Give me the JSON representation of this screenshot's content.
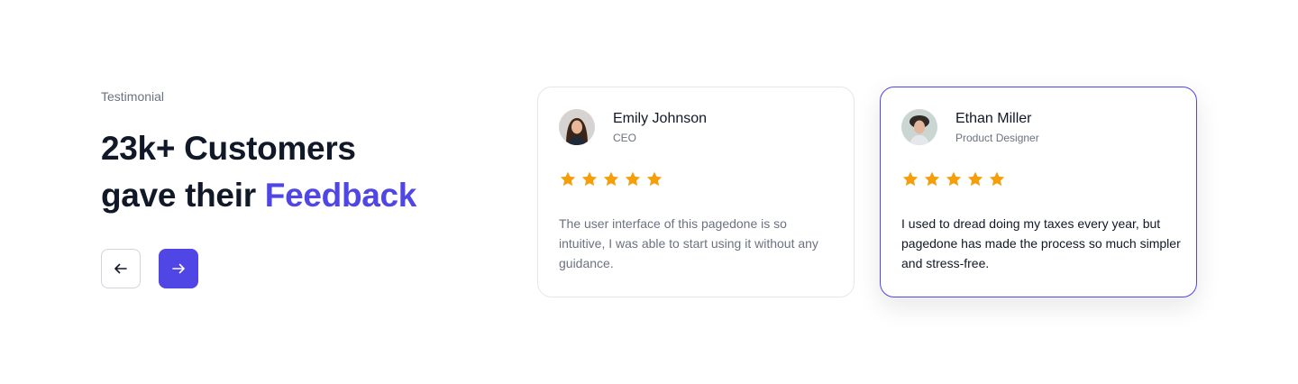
{
  "section": {
    "eyebrow": "Testimonial",
    "headline_line1": "23k+ Customers",
    "headline_line2_prefix": "gave their",
    "headline_accent": "Feedback"
  },
  "nav": {
    "prev_icon": "arrow-left-icon",
    "next_icon": "arrow-right-icon"
  },
  "colors": {
    "accent": "#4f46e5",
    "star": "#f59e0b",
    "heading": "#111827",
    "muted": "#6b7280"
  },
  "testimonials": [
    {
      "name": "Emily Johnson",
      "role": "CEO",
      "rating": 5,
      "quote": "The user interface of this pagedone is so intuitive, I was able to start using it without any guidance.",
      "active": false
    },
    {
      "name": "Ethan Miller",
      "role": "Product Designer",
      "rating": 5,
      "quote": "I used to dread doing my taxes every year, but pagedone has made the process so much simpler and stress-free.",
      "active": true
    }
  ]
}
